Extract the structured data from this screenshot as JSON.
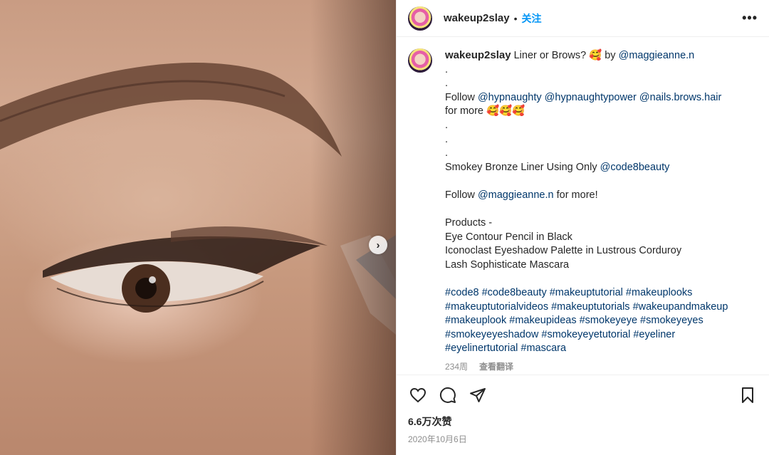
{
  "post": {
    "username": "wakeup2slay",
    "separator": "•",
    "follow_label": "关注",
    "more_label": "•••"
  },
  "caption": {
    "username": "wakeup2slay",
    "lines": [
      {
        "parts": [
          {
            "t": " Liner or Brows? 🥰 by "
          },
          {
            "t": "@maggieanne.n",
            "m": true
          }
        ]
      },
      {
        "parts": [
          {
            "t": "."
          }
        ]
      },
      {
        "parts": [
          {
            "t": "."
          }
        ]
      },
      {
        "parts": [
          {
            "t": "Follow "
          },
          {
            "t": "@hypnaughty",
            "m": true
          },
          {
            "t": " "
          },
          {
            "t": "@hypnaughtypower",
            "m": true
          },
          {
            "t": " "
          },
          {
            "t": "@nails.brows.hair",
            "m": true
          }
        ]
      },
      {
        "parts": [
          {
            "t": "for more 🥰🥰🥰"
          }
        ]
      },
      {
        "parts": [
          {
            "t": "."
          }
        ]
      },
      {
        "parts": [
          {
            "t": "."
          }
        ]
      },
      {
        "parts": [
          {
            "t": "."
          }
        ]
      },
      {
        "parts": [
          {
            "t": "Smokey Bronze Liner Using Only "
          },
          {
            "t": "@code8beauty",
            "m": true
          }
        ]
      },
      {
        "parts": [
          {
            "t": ""
          }
        ]
      },
      {
        "parts": [
          {
            "t": "Follow "
          },
          {
            "t": "@maggieanne.n",
            "m": true
          },
          {
            "t": " for more!"
          }
        ]
      },
      {
        "parts": [
          {
            "t": ""
          }
        ]
      },
      {
        "parts": [
          {
            "t": "Products -"
          }
        ]
      },
      {
        "parts": [
          {
            "t": "Eye Contour Pencil in Black"
          }
        ]
      },
      {
        "parts": [
          {
            "t": "Iconoclast Eyeshadow Palette in Lustrous Corduroy"
          }
        ]
      },
      {
        "parts": [
          {
            "t": "Lash Sophisticate Mascara"
          }
        ]
      },
      {
        "parts": [
          {
            "t": ""
          }
        ]
      },
      {
        "parts": [
          {
            "t": "#code8 #code8beauty #makeuptutorial #makeuplooks",
            "m": true
          }
        ]
      },
      {
        "parts": [
          {
            "t": "#makeuptutorialvideos #makeuptutorials #wakeupandmakeup",
            "m": true
          }
        ]
      },
      {
        "parts": [
          {
            "t": "#makeuplook #makeupideas #smokeyeye #smokeyeyes",
            "m": true
          }
        ]
      },
      {
        "parts": [
          {
            "t": "#smokeyeyeshadow #smokeyeyetutorial #eyeliner",
            "m": true
          }
        ]
      },
      {
        "parts": [
          {
            "t": "#eyelinertutorial #mascara",
            "m": true
          }
        ]
      }
    ],
    "age": "234周",
    "translate_label": "查看翻译"
  },
  "actions": {
    "icons": [
      "heart-icon",
      "comment-icon",
      "share-icon",
      "bookmark-icon"
    ]
  },
  "likes": "6.6万次赞",
  "date": "2020年10月6日",
  "colors": {
    "mention": "#00376b",
    "follow": "#0095f6",
    "muted": "#8e8e8e"
  }
}
